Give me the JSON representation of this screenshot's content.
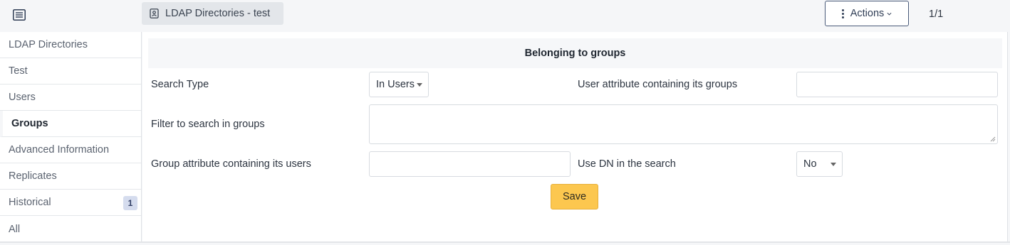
{
  "header": {
    "record_tab_label": "LDAP Directories - test",
    "actions_label": "Actions",
    "pager": "1/1"
  },
  "sidebar": {
    "items": [
      {
        "label": "LDAP Directories"
      },
      {
        "label": "Test"
      },
      {
        "label": "Users"
      },
      {
        "label": "Groups",
        "active": true
      },
      {
        "label": "Advanced Information"
      },
      {
        "label": "Replicates"
      },
      {
        "label": "Historical",
        "badge": "1"
      },
      {
        "label": "All"
      }
    ]
  },
  "form": {
    "section_title": "Belonging to groups",
    "search_type_label": "Search Type",
    "search_type_value": "In Users",
    "user_attr_label": "User attribute containing its groups",
    "user_attr_value": "",
    "filter_label": "Filter to search in groups",
    "filter_value": "",
    "group_attr_label": "Group attribute containing its users",
    "group_attr_value": "",
    "use_dn_label": "Use DN in the search",
    "use_dn_value": "No",
    "save_label": "Save"
  },
  "icons": {
    "list": "list-icon",
    "contact": "contact-card-icon",
    "dots": "vertical-dots-icon",
    "chevron": "chevron-down-icon"
  },
  "colors": {
    "save_button": "#fcc74f",
    "actions_border": "#4a5b7a",
    "badge_bg": "#d5dcee"
  }
}
